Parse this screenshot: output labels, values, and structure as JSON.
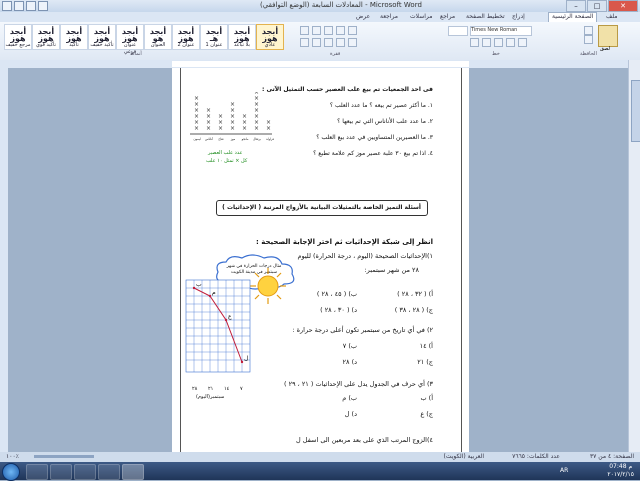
{
  "window": {
    "title": "المعادلات السابعة (الوضع التوافقي) - Microsoft Word",
    "minimize": "–",
    "maximize": "□",
    "close": "✕"
  },
  "ribbon": {
    "tabs": [
      "ملف",
      "الصفحة الرئيسية",
      "إدراج",
      "تخطيط الصفحة",
      "مراجع",
      "مراسلات",
      "مراجعة",
      "عرض"
    ],
    "active_tab": "الصفحة الرئيسية",
    "styles": [
      {
        "sample": "أبجد هوز",
        "name": "عادي"
      },
      {
        "sample": "أبجد هوز",
        "name": "بلا تباعد"
      },
      {
        "sample": "أبجد هـ",
        "name": "عنوان 1"
      },
      {
        "sample": "أبجد هوز",
        "name": "عنوان 2"
      },
      {
        "sample": "أبجد هو",
        "name": "العنوان"
      },
      {
        "sample": "أبجد هوز",
        "name": "عنوان فرعي"
      },
      {
        "sample": "أبجد هوز",
        "name": "تأكيد خفيف"
      },
      {
        "sample": "أبجد هوز",
        "name": "تأكيد"
      },
      {
        "sample": "أبجد هوز",
        "name": "تأكيد قوي"
      },
      {
        "sample": "أبجد هوز",
        "name": "مرجع خفيف"
      }
    ],
    "font_name": "Times New Roman",
    "group_labels": [
      "أنماط",
      "فقرة",
      "خط",
      "الحافظة"
    ],
    "clipboard_label": "لصق"
  },
  "document": {
    "q_intro": "فى احد الجمعيات تم بيع علب العصير حسب التمثيل الآتى :",
    "questions": [
      "١. ما أكثر عصير تم بيعه ؟ ما عدد العلب ؟",
      "٢. ما عدد علب الأناناس التي تم بيعها ؟",
      "٣. ما العصيرين المتساويين في عدد بيع العلب ؟",
      "٤. اذا تم بيع ٣٠ علبة عصير موز كم علامة  تطبع ؟"
    ],
    "plot_labels": [
      "فراولة",
      "برتقال",
      "مانجو",
      "موز",
      "تفاح",
      "أناناس",
      "ليمون"
    ],
    "plot_title": "عدد علب العصير",
    "plot_key": "كل × تمثل ١٠ علب",
    "section_heading": "أسئلة التميز الخاصة بالتمثيلات البيانية بالأزواج المرتبة ( الإحداثيات )",
    "grid_intro": "انظر إلى شبكة الإحداثيات ثم اختر الإجابة الصحيحة :",
    "cloud_text": "مثال درجات الحرارة في شهر سبتمبر في مدينة الكويت",
    "g_q1_a": "١)الإحداثيات الصحيحة (اليوم ، درجة الحرارة) لليوم",
    "g_q1_b": "٢٨ من شهر سبتمبر:",
    "g_q1_opts": [
      "أ) ( ٣٢ ، ٢٨ )",
      "ب) ( ٤٥ ، ٢٨ )",
      "ج) ( ٢٨ ، ٣٨ )",
      "د) ( ٣٠ ، ٢٨ )"
    ],
    "g_q2": "٢) في أي تاريخ من سبتمبر تكون أعلى درجة حرارة :",
    "g_q2_opts": [
      "أ) ١٤",
      "ب) ٧",
      "ج) ٢١",
      "د) ٢٨"
    ],
    "g_q3": "٣) أي حرف في الجدول يدل على الإحداثيات ( ٢١ ، ٢٩ )",
    "g_q3_opts": [
      "أ) ب",
      "ب) م",
      "ج) ع",
      "د) ل"
    ],
    "g_q4": "٤)الزوج المرتب الذي على بعد مربعين الى اسفل ل",
    "grid_letters": [
      "ع",
      "م",
      "ب",
      "ل"
    ],
    "grid_xlabel": "سبتمبر(اليوم)",
    "grid_xticks": [
      "٧",
      "١٤",
      "٢١",
      "٢٨"
    ]
  },
  "statusbar": {
    "page": "الصفحة: ٤ من ٣٧",
    "words": "عدد الكلمات: ٧٦٦٥",
    "lang": "العربية (الكويت)",
    "zoom": "١٠٠٪"
  },
  "taskbar": {
    "lang": "AR",
    "time": "07:48 م",
    "date": "٢٠١٧/٢/١٥"
  },
  "colors": {
    "accent": "#2b579a",
    "frame": "#555555",
    "note_green": "#1a8a1a"
  }
}
